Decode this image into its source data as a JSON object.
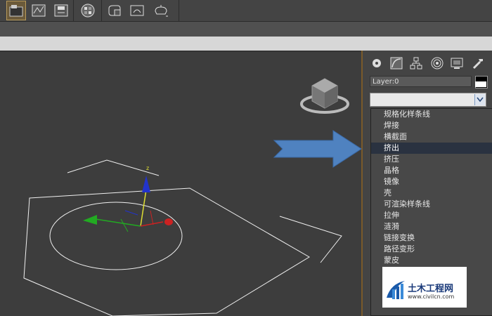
{
  "toolbar": {
    "icons": [
      "open-icon",
      "curve-editor-icon",
      "save-icon",
      "material-icon",
      "render-setup-icon",
      "rendered-frame-icon",
      "render-icon"
    ]
  },
  "panel": {
    "tabs": [
      "create-tab",
      "modify-tab",
      "hierarchy-tab",
      "motion-tab",
      "display-tab",
      "utilities-tab"
    ],
    "layer_label": "Layer:0",
    "dropdown_value": "",
    "modifier_list": [
      "规格化样条线",
      "焊接",
      "横截面",
      "挤出",
      "挤压",
      "晶格",
      "镜像",
      "壳",
      "可渲染样条线",
      "拉伸",
      "涟漪",
      "链接变换",
      "路径变形",
      "蒙皮"
    ],
    "selected_index": 3
  },
  "viewport": {
    "axis_label": "z"
  },
  "watermark": {
    "title": "土木工程网",
    "url": "www.civilcn.com"
  },
  "colors": {
    "selection": "#2a3240",
    "arrow": "#4f82c0",
    "axis_x": "#cc2222",
    "axis_y": "#22aa22",
    "axis_z": "#2233cc"
  }
}
